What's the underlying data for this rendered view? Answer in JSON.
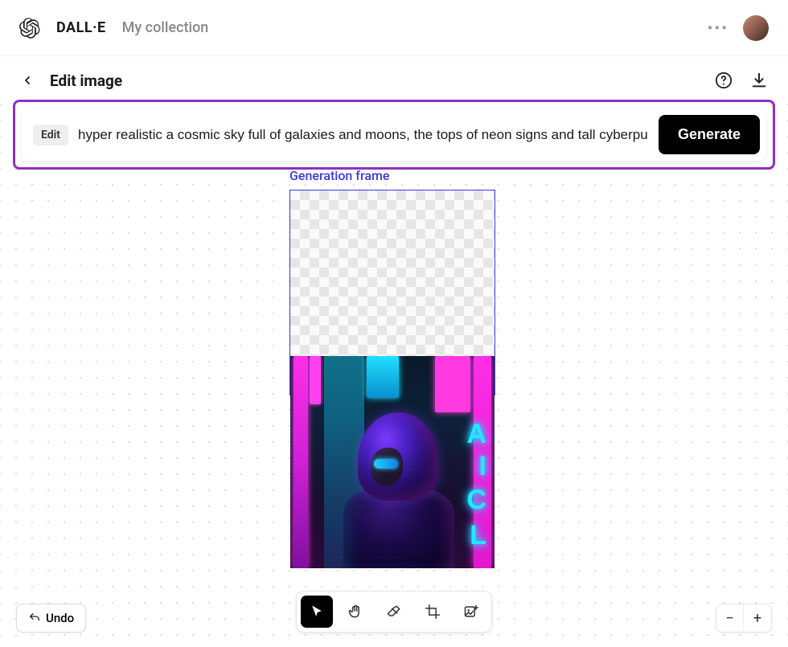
{
  "header": {
    "brand": "DALL·E",
    "nav_my_collection": "My collection"
  },
  "toolbar": {
    "page_title": "Edit image"
  },
  "prompt": {
    "edit_tag": "Edit",
    "value": "hyper realistic a cosmic sky full of galaxies and moons, the tops of neon signs and tall cyberpu",
    "generate_label": "Generate"
  },
  "canvas": {
    "frame_label": "Generation frame",
    "neon_letters": {
      "a": "A",
      "i": "I",
      "c": "C",
      "l": "L"
    }
  },
  "bottom": {
    "undo_label": "Undo",
    "zoom_out": "−",
    "zoom_in": "+"
  },
  "tools": {
    "select": "select",
    "pan": "pan",
    "erase": "erase",
    "crop": "crop",
    "add_image": "add-image"
  }
}
